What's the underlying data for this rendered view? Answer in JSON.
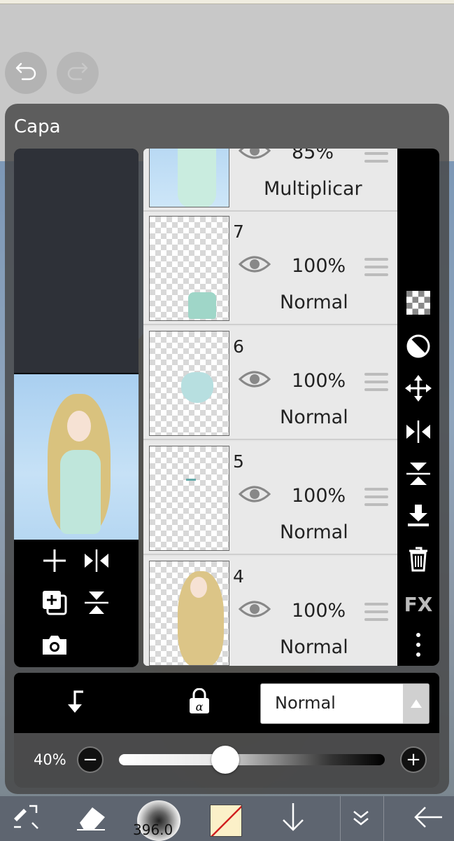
{
  "panel": {
    "title": "Capa"
  },
  "layers": [
    {
      "number": "",
      "opacity": "85%",
      "blend": "Multiplicar"
    },
    {
      "number": "7",
      "opacity": "100%",
      "blend": "Normal"
    },
    {
      "number": "6",
      "opacity": "100%",
      "blend": "Normal"
    },
    {
      "number": "5",
      "opacity": "100%",
      "blend": "Normal"
    },
    {
      "number": "4",
      "opacity": "100%",
      "blend": "Normal"
    }
  ],
  "right_toolbar": {
    "fx_label": "FX"
  },
  "blend_mode": {
    "selected": "Normal"
  },
  "opacity": {
    "label": "40%",
    "value": 0.4
  },
  "bottom_toolbar": {
    "brush_size": "396.0"
  },
  "colors": {
    "accent_bg": "#000000",
    "panel": "#464646",
    "list_bg": "#e6e6e6"
  }
}
